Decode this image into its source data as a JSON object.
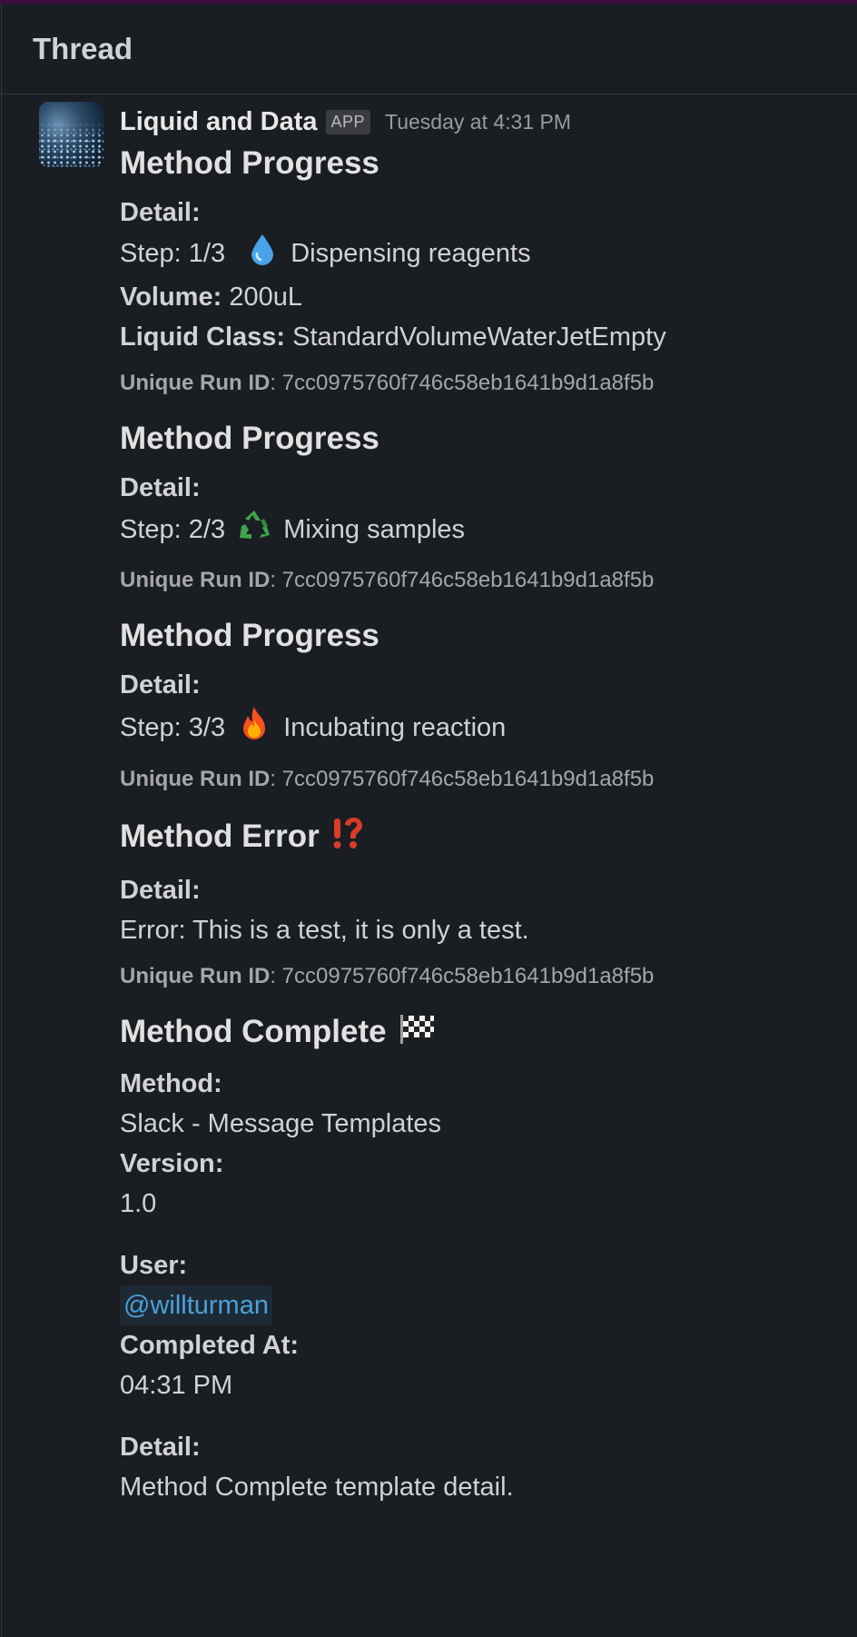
{
  "header": {
    "title": "Thread"
  },
  "message": {
    "sender": "Liquid and Data",
    "badge": "APP",
    "timestamp": "Tuesday at 4:31 PM"
  },
  "blocks": [
    {
      "title": "Method Progress",
      "detail_label": "Detail:",
      "step_prefix": "Step: 1/3",
      "step_icon": "droplet-icon",
      "step_text": "Dispensing reagents",
      "volume_label": "Volume:",
      "volume_value": "200uL",
      "liquid_class_label": "Liquid Class:",
      "liquid_class_value": "StandardVolumeWaterJetEmpty",
      "runid_label": "Unique Run ID",
      "runid_value": ": 7cc0975760f746c58eb1641b9d1a8f5b"
    },
    {
      "title": "Method Progress",
      "detail_label": "Detail:",
      "step_prefix": "Step: 2/3",
      "step_icon": "recycle-icon",
      "step_text": "Mixing samples",
      "runid_label": "Unique Run ID",
      "runid_value": ": 7cc0975760f746c58eb1641b9d1a8f5b"
    },
    {
      "title": "Method Progress",
      "detail_label": "Detail:",
      "step_prefix": "Step: 3/3",
      "step_icon": "fire-icon",
      "step_text": "Incubating reaction",
      "runid_label": "Unique Run ID",
      "runid_value": ": 7cc0975760f746c58eb1641b9d1a8f5b"
    },
    {
      "title": "Method Error",
      "title_icon": "interrobang-icon",
      "detail_label": "Detail:",
      "error_text": "Error: This is a test, it is only a test.",
      "runid_label": "Unique Run ID",
      "runid_value": ": 7cc0975760f746c58eb1641b9d1a8f5b"
    },
    {
      "title": "Method Complete",
      "title_icon": "checkered-flag-icon",
      "method_label": "Method:",
      "method_value": "Slack - Message Templates",
      "version_label": "Version:",
      "version_value": "1.0",
      "user_label": "User:",
      "user_value": "@willturman",
      "completed_label": "Completed At:",
      "completed_value": "04:31 PM",
      "detail_label": "Detail:",
      "detail_value": "Method Complete template detail."
    }
  ],
  "colors": {
    "background": "#1a1d21",
    "text": "#d1d2d3",
    "mention": "#4ca0d9",
    "workspace_bar": "#3f0e40"
  }
}
